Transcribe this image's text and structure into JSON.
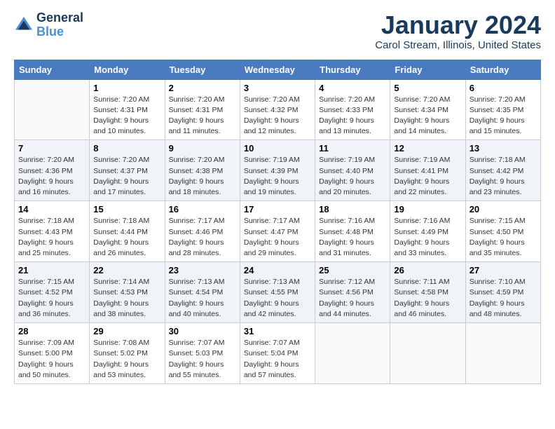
{
  "header": {
    "logo_line1": "General",
    "logo_line2": "Blue",
    "month": "January 2024",
    "location": "Carol Stream, Illinois, United States"
  },
  "days_of_week": [
    "Sunday",
    "Monday",
    "Tuesday",
    "Wednesday",
    "Thursday",
    "Friday",
    "Saturday"
  ],
  "weeks": [
    [
      {
        "day": "",
        "info": ""
      },
      {
        "day": "1",
        "info": "Sunrise: 7:20 AM\nSunset: 4:31 PM\nDaylight: 9 hours\nand 10 minutes."
      },
      {
        "day": "2",
        "info": "Sunrise: 7:20 AM\nSunset: 4:31 PM\nDaylight: 9 hours\nand 11 minutes."
      },
      {
        "day": "3",
        "info": "Sunrise: 7:20 AM\nSunset: 4:32 PM\nDaylight: 9 hours\nand 12 minutes."
      },
      {
        "day": "4",
        "info": "Sunrise: 7:20 AM\nSunset: 4:33 PM\nDaylight: 9 hours\nand 13 minutes."
      },
      {
        "day": "5",
        "info": "Sunrise: 7:20 AM\nSunset: 4:34 PM\nDaylight: 9 hours\nand 14 minutes."
      },
      {
        "day": "6",
        "info": "Sunrise: 7:20 AM\nSunset: 4:35 PM\nDaylight: 9 hours\nand 15 minutes."
      }
    ],
    [
      {
        "day": "7",
        "info": "Sunrise: 7:20 AM\nSunset: 4:36 PM\nDaylight: 9 hours\nand 16 minutes."
      },
      {
        "day": "8",
        "info": "Sunrise: 7:20 AM\nSunset: 4:37 PM\nDaylight: 9 hours\nand 17 minutes."
      },
      {
        "day": "9",
        "info": "Sunrise: 7:20 AM\nSunset: 4:38 PM\nDaylight: 9 hours\nand 18 minutes."
      },
      {
        "day": "10",
        "info": "Sunrise: 7:19 AM\nSunset: 4:39 PM\nDaylight: 9 hours\nand 19 minutes."
      },
      {
        "day": "11",
        "info": "Sunrise: 7:19 AM\nSunset: 4:40 PM\nDaylight: 9 hours\nand 20 minutes."
      },
      {
        "day": "12",
        "info": "Sunrise: 7:19 AM\nSunset: 4:41 PM\nDaylight: 9 hours\nand 22 minutes."
      },
      {
        "day": "13",
        "info": "Sunrise: 7:18 AM\nSunset: 4:42 PM\nDaylight: 9 hours\nand 23 minutes."
      }
    ],
    [
      {
        "day": "14",
        "info": "Sunrise: 7:18 AM\nSunset: 4:43 PM\nDaylight: 9 hours\nand 25 minutes."
      },
      {
        "day": "15",
        "info": "Sunrise: 7:18 AM\nSunset: 4:44 PM\nDaylight: 9 hours\nand 26 minutes."
      },
      {
        "day": "16",
        "info": "Sunrise: 7:17 AM\nSunset: 4:46 PM\nDaylight: 9 hours\nand 28 minutes."
      },
      {
        "day": "17",
        "info": "Sunrise: 7:17 AM\nSunset: 4:47 PM\nDaylight: 9 hours\nand 29 minutes."
      },
      {
        "day": "18",
        "info": "Sunrise: 7:16 AM\nSunset: 4:48 PM\nDaylight: 9 hours\nand 31 minutes."
      },
      {
        "day": "19",
        "info": "Sunrise: 7:16 AM\nSunset: 4:49 PM\nDaylight: 9 hours\nand 33 minutes."
      },
      {
        "day": "20",
        "info": "Sunrise: 7:15 AM\nSunset: 4:50 PM\nDaylight: 9 hours\nand 35 minutes."
      }
    ],
    [
      {
        "day": "21",
        "info": "Sunrise: 7:15 AM\nSunset: 4:52 PM\nDaylight: 9 hours\nand 36 minutes."
      },
      {
        "day": "22",
        "info": "Sunrise: 7:14 AM\nSunset: 4:53 PM\nDaylight: 9 hours\nand 38 minutes."
      },
      {
        "day": "23",
        "info": "Sunrise: 7:13 AM\nSunset: 4:54 PM\nDaylight: 9 hours\nand 40 minutes."
      },
      {
        "day": "24",
        "info": "Sunrise: 7:13 AM\nSunset: 4:55 PM\nDaylight: 9 hours\nand 42 minutes."
      },
      {
        "day": "25",
        "info": "Sunrise: 7:12 AM\nSunset: 4:56 PM\nDaylight: 9 hours\nand 44 minutes."
      },
      {
        "day": "26",
        "info": "Sunrise: 7:11 AM\nSunset: 4:58 PM\nDaylight: 9 hours\nand 46 minutes."
      },
      {
        "day": "27",
        "info": "Sunrise: 7:10 AM\nSunset: 4:59 PM\nDaylight: 9 hours\nand 48 minutes."
      }
    ],
    [
      {
        "day": "28",
        "info": "Sunrise: 7:09 AM\nSunset: 5:00 PM\nDaylight: 9 hours\nand 50 minutes."
      },
      {
        "day": "29",
        "info": "Sunrise: 7:08 AM\nSunset: 5:02 PM\nDaylight: 9 hours\nand 53 minutes."
      },
      {
        "day": "30",
        "info": "Sunrise: 7:07 AM\nSunset: 5:03 PM\nDaylight: 9 hours\nand 55 minutes."
      },
      {
        "day": "31",
        "info": "Sunrise: 7:07 AM\nSunset: 5:04 PM\nDaylight: 9 hours\nand 57 minutes."
      },
      {
        "day": "",
        "info": ""
      },
      {
        "day": "",
        "info": ""
      },
      {
        "day": "",
        "info": ""
      }
    ]
  ]
}
